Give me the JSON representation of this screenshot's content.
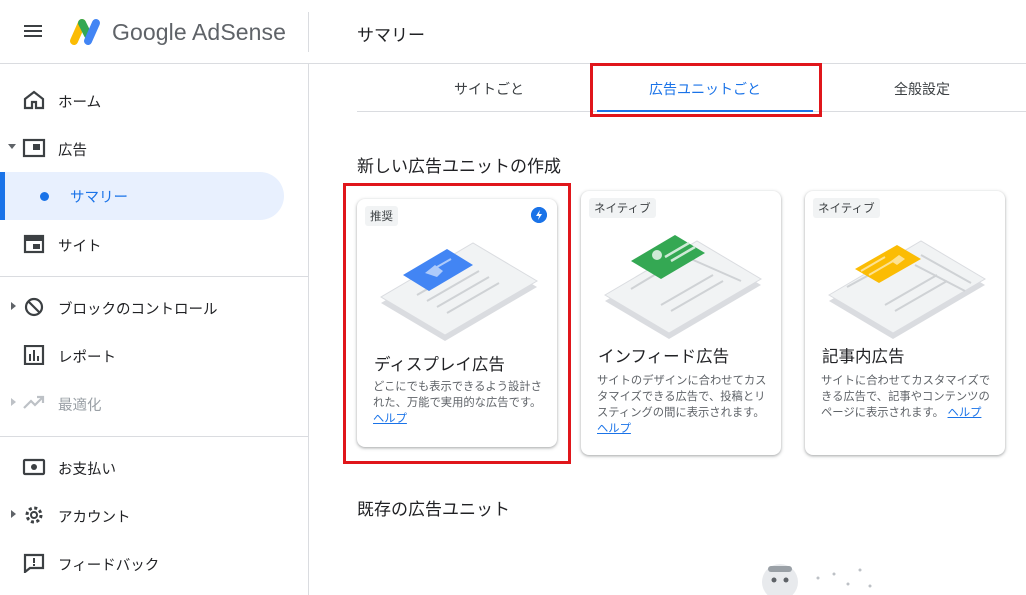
{
  "app": {
    "brand": "Google AdSense",
    "page_title": "サマリー"
  },
  "sidebar": {
    "items": [
      {
        "label": "ホーム",
        "icon": "home-icon"
      },
      {
        "label": "広告",
        "icon": "ads-icon"
      },
      {
        "label": "サマリー",
        "icon": "dot"
      },
      {
        "label": "サイト",
        "icon": "sites-icon"
      },
      {
        "label": "ブロックのコントロール",
        "icon": "block-icon"
      },
      {
        "label": "レポート",
        "icon": "report-icon"
      },
      {
        "label": "最適化",
        "icon": "trending-icon"
      },
      {
        "label": "お支払い",
        "icon": "payments-icon"
      },
      {
        "label": "アカウント",
        "icon": "gear-icon"
      },
      {
        "label": "フィードバック",
        "icon": "feedback-icon"
      }
    ]
  },
  "tabs": [
    {
      "label": "サイトごと"
    },
    {
      "label": "広告ユニットごと"
    },
    {
      "label": "全般設定"
    }
  ],
  "main": {
    "new_section_title": "新しい広告ユニットの作成",
    "existing_section_title": "既存の広告ユニット",
    "cards": [
      {
        "badge": "推奨",
        "title": "ディスプレイ広告",
        "desc": "どこにでも表示できるよう設計された、万能で実用的な広告です。",
        "help": "ヘルプ"
      },
      {
        "badge": "ネイティブ",
        "title": "インフィード広告",
        "desc": "サイトのデザインに合わせてカスタマイズできる広告で、投稿とリスティングの間に表示されます。",
        "help": "ヘルプ"
      },
      {
        "badge": "ネイティブ",
        "title": "記事内広告",
        "desc": "サイトに合わせてカスタマイズできる広告で、記事やコンテンツのページに表示されます。",
        "help": "ヘルプ"
      }
    ]
  },
  "colors": {
    "accent": "#1a73e8",
    "highlight": "#e0161b",
    "active_bg": "#e8f0fe",
    "card1_ad": "#4285f4",
    "card2_ad": "#34a853",
    "card3_ad": "#fbbc04"
  }
}
